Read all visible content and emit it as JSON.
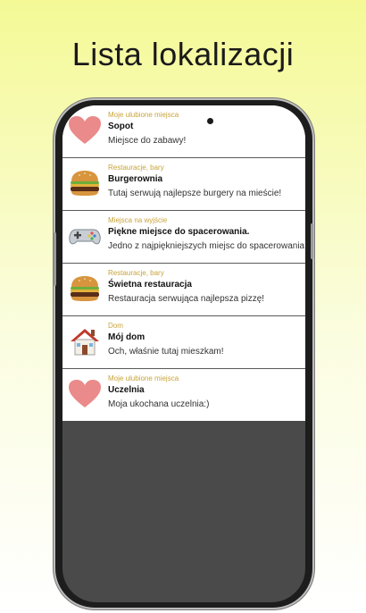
{
  "header": {
    "title": "Lista lokalizacji"
  },
  "locations": [
    {
      "category": "Moje ulubione miejsca",
      "name": "Sopot",
      "description": "Miejsce do zabawy!",
      "icon": "heart-icon"
    },
    {
      "category": "Restauracje, bary",
      "name": "Burgerownia",
      "description": "Tutaj serwują najlepsze burgery na mieście!",
      "icon": "burger-icon"
    },
    {
      "category": "Miejsca na wyjście",
      "name": "Piękne miejsce do spacerowania.",
      "description": "Jedno z najpiękniejszych miejsc do spacerowania",
      "icon": "gamepad-icon"
    },
    {
      "category": "Restauracje, bary",
      "name": "Świetna restauracja",
      "description": "Restauracja serwująca najlepsza pizzę!",
      "icon": "burger-icon"
    },
    {
      "category": "Dom",
      "name": "Mój dom",
      "description": "Och, właśnie tutaj mieszkam!",
      "icon": "house-icon"
    },
    {
      "category": "Moje ulubione miejsca",
      "name": "Uczelnia",
      "description": "Moja ukochana uczelnia:)",
      "icon": "heart-icon"
    }
  ],
  "colors": {
    "category_text": "#c8a43a",
    "heart": "#ea8a8a",
    "empty_area": "#4a4a4a"
  }
}
